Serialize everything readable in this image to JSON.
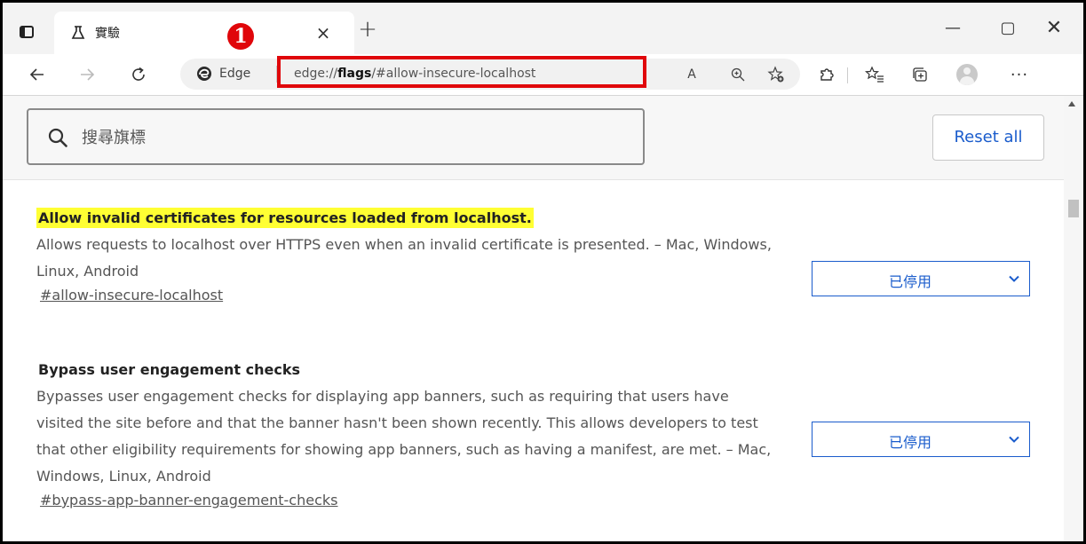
{
  "tab": {
    "title": "實驗",
    "close_glyph": "×"
  },
  "new_tab_glyph": "+",
  "window_controls": {
    "minimize": "—",
    "maximize": "▢",
    "close": "✕"
  },
  "step_badge": "1",
  "addressbar": {
    "site_label": "Edge",
    "url_prefix": "edge://",
    "url_bold": "flags",
    "url_suffix": "/#allow-insecure-localhost"
  },
  "icons": {
    "read_aloud": "A",
    "more": "···"
  },
  "search": {
    "placeholder": "搜尋旗標"
  },
  "reset_label": "Reset all",
  "flags": [
    {
      "title": "Allow invalid certificates for resources loaded from localhost.",
      "description": "Allows requests to localhost over HTTPS even when an invalid certificate is presented. – Mac, Windows, Linux, Android",
      "link": "#allow-insecure-localhost",
      "state": "已停用"
    },
    {
      "title": "Bypass user engagement checks",
      "description": "Bypasses user engagement checks for displaying app banners, such as requiring that users have visited the site before and that the banner hasn't been shown recently. This allows developers to test that other eligibility requirements for showing app banners, such as having a manifest, are met. – Mac, Windows, Linux, Android",
      "link": "#bypass-app-banner-engagement-checks",
      "state": "已停用"
    }
  ],
  "colors": {
    "accent_blue": "#1a5ccc",
    "highlight_yellow": "#ffff33",
    "annotation_red": "#e0060a"
  }
}
